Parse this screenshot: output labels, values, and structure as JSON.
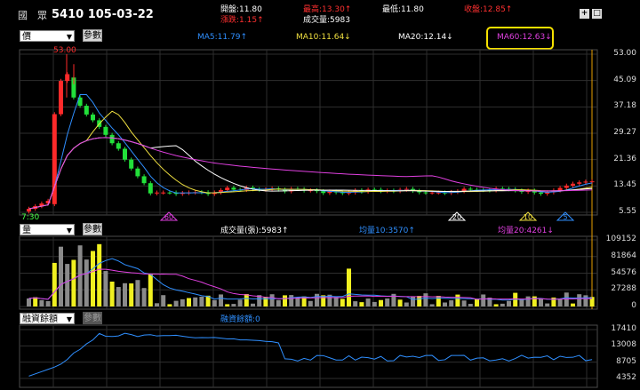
{
  "header": {
    "name_char_1": "國",
    "name_char_2": "眾",
    "code_date": "5410 105-03-22",
    "open_label": "開盤:11.80",
    "high_label": "最高:13.30↑",
    "low_label": "最低:11.80",
    "close_label": "收盤:12.85↑",
    "change_label": "漲跌:1.15↑",
    "volume_label": "成交量:5983",
    "colors": {
      "up": "#ff3030",
      "neutral": "#ffffff"
    }
  },
  "window_controls": {
    "plus_label": "+",
    "restore_label": "□"
  },
  "price_panel": {
    "period_select": "價",
    "param_button": "參數",
    "ma_labels": {
      "ma5": "MA5:11.79↑",
      "ma10": "MA10:11.64↓",
      "ma20": "MA20:12.14↓",
      "ma60": "MA60:12.63↓"
    },
    "ma_colors": {
      "ma5": "#2f8fff",
      "ma10": "#f0e040",
      "ma20": "#ffffff",
      "ma60": "#e040e0"
    },
    "peak_label": "53.00",
    "date_label": "7:30",
    "y_ticks": [
      "53.00",
      "45.09",
      "37.18",
      "29.27",
      "21.36",
      "13.45",
      "5.55"
    ],
    "markers": [
      "60",
      "20",
      "10",
      "5"
    ]
  },
  "volume_panel": {
    "select": "量",
    "param_button": "參數",
    "volume_label": "成交量(張):5983↑",
    "avg10_label": "均量10:3570↑",
    "avg20_label": "均量20:4261↓",
    "y_ticks": [
      "109152",
      "81864",
      "54576",
      "27288",
      "0"
    ],
    "colors": {
      "yellow": "#f0f020",
      "gray": "#8a8a8a"
    }
  },
  "margin_panel": {
    "select": "融資餘額",
    "param_button": "參數",
    "label": "融資餘額:0",
    "y_ticks": [
      "17410",
      "13008",
      "8705",
      "4352"
    ],
    "line_color": "#2f8fff"
  }
}
